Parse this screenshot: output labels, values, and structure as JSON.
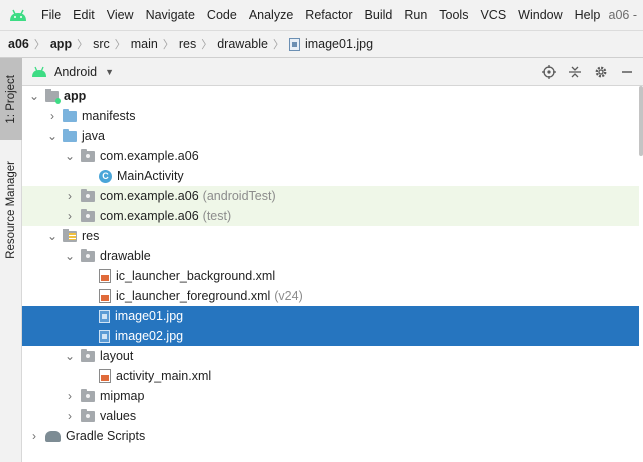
{
  "menu": {
    "items": [
      "File",
      "Edit",
      "View",
      "Navigate",
      "Code",
      "Analyze",
      "Refactor",
      "Build",
      "Run",
      "Tools",
      "VCS",
      "Window",
      "Help"
    ],
    "project_title": "a06 - "
  },
  "breadcrumb": {
    "items": [
      "a06",
      "app",
      "src",
      "main",
      "res",
      "drawable",
      "image01.jpg"
    ]
  },
  "sidestrip": {
    "project_tab": "1: Project",
    "resource_tab": "Resource Manager"
  },
  "panel": {
    "view_label": "Android"
  },
  "tree": {
    "rows": [
      {
        "label": "app",
        "suffix": ""
      },
      {
        "label": "manifests",
        "suffix": ""
      },
      {
        "label": "java",
        "suffix": ""
      },
      {
        "label": "com.example.a06",
        "suffix": ""
      },
      {
        "label": "MainActivity",
        "suffix": ""
      },
      {
        "label": "com.example.a06",
        "suffix": "(androidTest)"
      },
      {
        "label": "com.example.a06",
        "suffix": "(test)"
      },
      {
        "label": "res",
        "suffix": ""
      },
      {
        "label": "drawable",
        "suffix": ""
      },
      {
        "label": "ic_launcher_background.xml",
        "suffix": ""
      },
      {
        "label": "ic_launcher_foreground.xml",
        "suffix": "(v24)"
      },
      {
        "label": "image01.jpg",
        "suffix": ""
      },
      {
        "label": "image02.jpg",
        "suffix": ""
      },
      {
        "label": "layout",
        "suffix": ""
      },
      {
        "label": "activity_main.xml",
        "suffix": ""
      },
      {
        "label": "mipmap",
        "suffix": ""
      },
      {
        "label": "values",
        "suffix": ""
      },
      {
        "label": "Gradle Scripts",
        "suffix": ""
      }
    ]
  },
  "colors": {
    "selection": "#2675bf",
    "test_highlight": "#eff7e8",
    "android_green": "#3ddc84"
  },
  "icons": {
    "class_letter": "C"
  }
}
